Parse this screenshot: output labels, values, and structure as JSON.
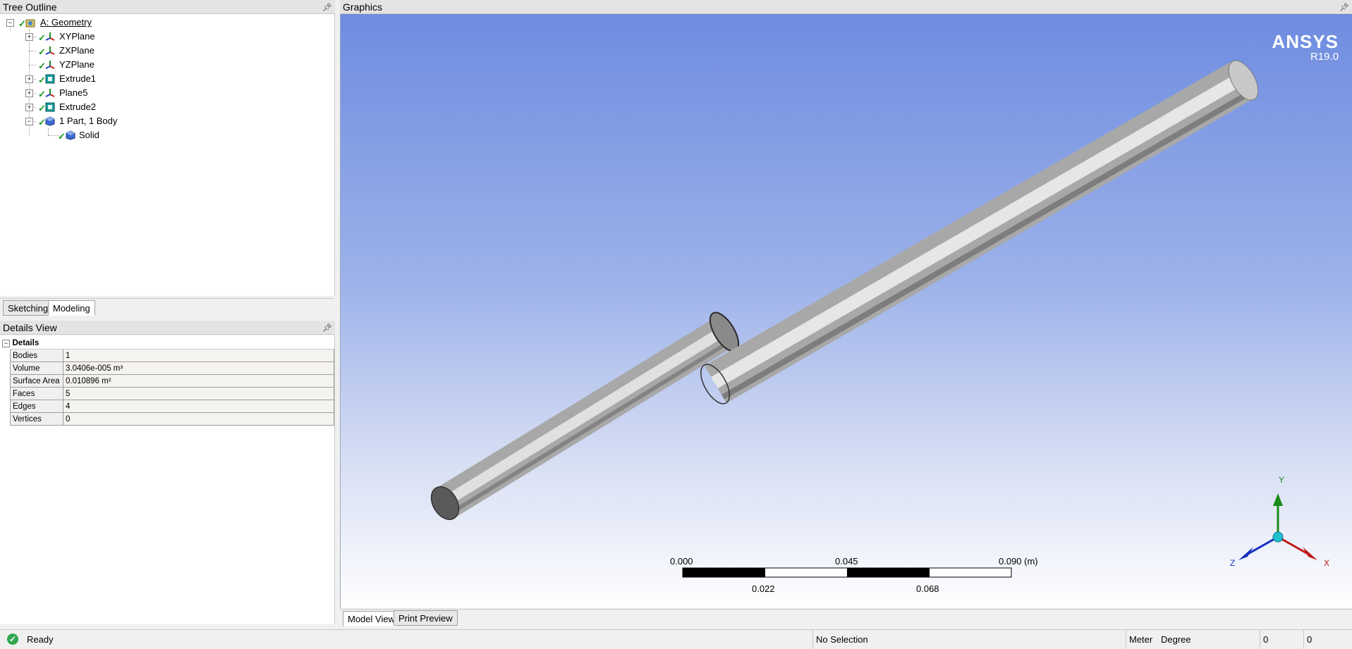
{
  "tree_outline": {
    "title": "Tree Outline",
    "items": [
      {
        "label": "A: Geometry",
        "icon": "geometry-icon"
      },
      {
        "label": "XYPlane",
        "icon": "plane-axes-icon"
      },
      {
        "label": "ZXPlane",
        "icon": "plane-axes-icon"
      },
      {
        "label": "YZPlane",
        "icon": "plane-axes-icon"
      },
      {
        "label": "Extrude1",
        "icon": "extrude-icon"
      },
      {
        "label": "Plane5",
        "icon": "plane-axes-icon"
      },
      {
        "label": "Extrude2",
        "icon": "extrude-icon"
      },
      {
        "label": "1 Part, 1 Body",
        "icon": "parts-icon"
      },
      {
        "label": "Solid",
        "icon": "solid-body-icon"
      }
    ],
    "tabs": [
      "Sketching",
      "Modeling"
    ],
    "active_tab": "Modeling"
  },
  "details_view": {
    "title": "Details View",
    "section": "Details",
    "rows": [
      {
        "name": "Bodies",
        "value": "1"
      },
      {
        "name": "Volume",
        "value": "3.0406e-005 m³"
      },
      {
        "name": "Surface Area",
        "value": "0.010896 m²"
      },
      {
        "name": "Faces",
        "value": "5"
      },
      {
        "name": "Edges",
        "value": "4"
      },
      {
        "name": "Vertices",
        "value": "0"
      }
    ]
  },
  "graphics": {
    "title": "Graphics",
    "logo": "ANSYS",
    "version": "R19.0",
    "scale_bar": {
      "top_labels": [
        "0.000",
        "0.045",
        "0.090 (m)"
      ],
      "bottom_labels": [
        "0.022",
        "0.068"
      ]
    },
    "triad": {
      "x": "X",
      "y": "Y",
      "z": "Z"
    },
    "tabs": [
      "Model View",
      "Print Preview"
    ],
    "active_tab": "Model View"
  },
  "status_bar": {
    "status": "Ready",
    "selection": "No Selection",
    "length_unit": "Meter",
    "angle_unit": "Degree",
    "value1": "0",
    "value2": "0"
  },
  "colors": {
    "check": "#1a9a1a",
    "viewport_top": "#6e8ce0",
    "viewport_bottom": "#ffffff"
  }
}
